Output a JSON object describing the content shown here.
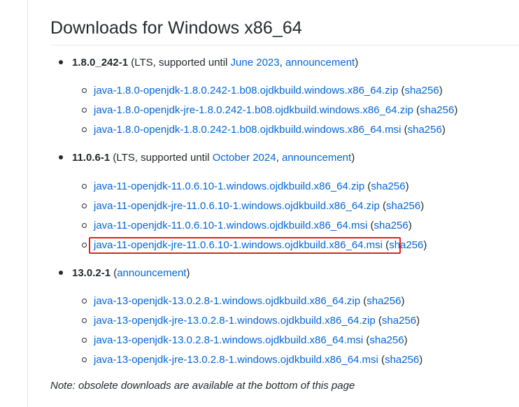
{
  "heading": "Downloads for Windows x86_64",
  "releases": [
    {
      "version": "1.8.0_242-1",
      "prefix": "(LTS, supported until ",
      "support_link": "June 2023",
      "separator": ",",
      "announcement": "announcement",
      "suffix": ")",
      "files": [
        {
          "name": "java-1.8.0-openjdk-1.8.0.242-1.b08.ojdkbuild.windows.x86_64.zip",
          "sha": "sha256"
        },
        {
          "name": "java-1.8.0-openjdk-jre-1.8.0.242-1.b08.ojdkbuild.windows.x86_64.zip",
          "sha": "sha256"
        },
        {
          "name": "java-1.8.0-openjdk-1.8.0.242-1.b08.ojdkbuild.windows.x86_64.msi",
          "sha": "sha256"
        }
      ]
    },
    {
      "version": "11.0.6-1",
      "prefix": "(LTS, supported until ",
      "support_link": "October 2024",
      "separator": ",",
      "announcement": "announcement",
      "suffix": ")",
      "files": [
        {
          "name": "java-11-openjdk-11.0.6.10-1.windows.ojdkbuild.x86_64.zip",
          "sha": "sha256"
        },
        {
          "name": "java-11-openjdk-jre-11.0.6.10-1.windows.ojdkbuild.x86_64.zip",
          "sha": "sha256"
        },
        {
          "name": "java-11-openjdk-11.0.6.10-1.windows.ojdkbuild.x86_64.msi",
          "sha": "sha256"
        },
        {
          "name": "java-11-openjdk-jre-11.0.6.10-1.windows.ojdkbuild.x86_64.msi",
          "sha": "sha256",
          "highlighted": true
        }
      ]
    },
    {
      "version": "13.0.2-1",
      "prefix": "(",
      "announcement": "announcement",
      "suffix": ")",
      "files": [
        {
          "name": "java-13-openjdk-13.0.2.8-1.windows.ojdkbuild.x86_64.zip",
          "sha": "sha256"
        },
        {
          "name": "java-13-openjdk-jre-13.0.2.8-1.windows.ojdkbuild.x86_64.zip",
          "sha": "sha256"
        },
        {
          "name": "java-13-openjdk-13.0.2.8-1.windows.ojdkbuild.x86_64.msi",
          "sha": "sha256"
        },
        {
          "name": "java-13-openjdk-jre-13.0.2.8-1.windows.ojdkbuild.x86_64.msi",
          "sha": "sha256"
        }
      ]
    }
  ],
  "note": "Note: obsolete downloads are available at the bottom of this page",
  "colors": {
    "link": "#0366d6",
    "text": "#24292e",
    "highlight": "#e02020"
  }
}
